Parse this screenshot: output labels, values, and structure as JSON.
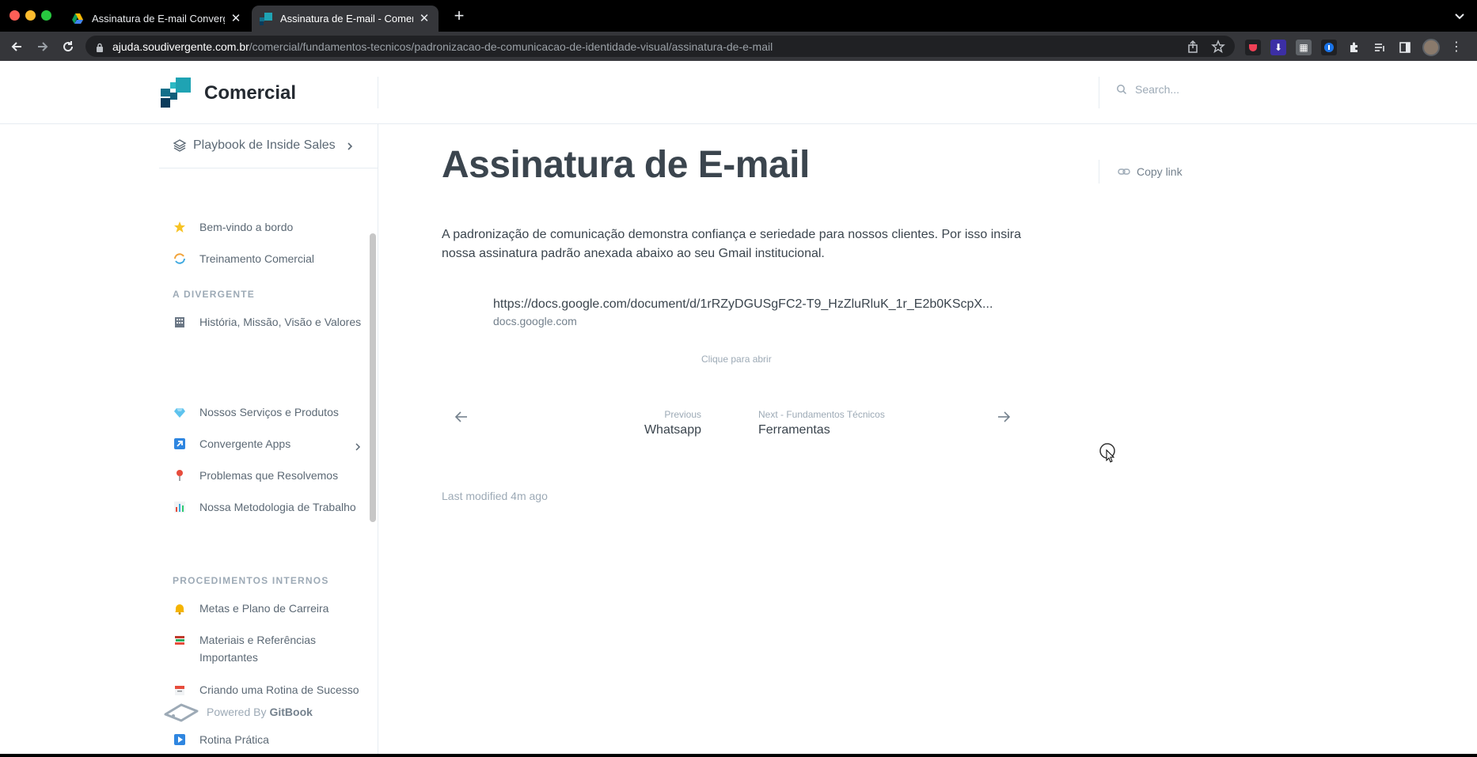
{
  "browser": {
    "tabs": [
      {
        "title": "Assinatura de E-mail Converge",
        "active": false,
        "favicon": "google-drive-icon"
      },
      {
        "title": "Assinatura de E-mail - Comerci",
        "active": true,
        "favicon": "gitbook-space-icon"
      }
    ],
    "url_host": "ajuda.soudivergente.com.br",
    "url_path": "/comercial/fundamentos-tecnicos/padronizacao-de-comunicacao-de-identidade-visual/assinatura-de-e-mail"
  },
  "header": {
    "space_title": "Comercial",
    "search_placeholder": "Search..."
  },
  "sidebar": {
    "space_switch_label": "Playbook de Inside Sales",
    "top_items": [
      {
        "label": "Bem-vindo a bordo",
        "icon": "star-icon"
      },
      {
        "label": "Treinamento Comercial",
        "icon": "cycle-icon"
      }
    ],
    "sections": [
      {
        "title": "A DIVERGENTE",
        "items": [
          {
            "label": "História, Missão, Visão e Valores",
            "icon": "building-icon"
          },
          {
            "label": "Nossos Serviços e Produtos",
            "icon": "gem-icon"
          },
          {
            "label": "Convergente Apps",
            "icon": "arrow-up-right-icon",
            "has_children": true
          },
          {
            "label": "Problemas que Resolvemos",
            "icon": "pin-icon"
          },
          {
            "label": "Nossa  Metodologia de Trabalho",
            "icon": "bar-chart-icon"
          }
        ]
      },
      {
        "title": "PROCEDIMENTOS INTERNOS",
        "items": [
          {
            "label": "Metas e Plano de Carreira",
            "icon": "bell-icon"
          },
          {
            "label": "Materiais e Referências Importantes",
            "icon": "books-icon"
          },
          {
            "label": "Criando uma Rotina de Sucesso",
            "icon": "calendar-icon"
          },
          {
            "label": "Rotina Prática",
            "icon": "play-icon"
          }
        ]
      }
    ],
    "powered_prefix": "Powered By",
    "powered_brand": "GitBook"
  },
  "main": {
    "title": "Assinatura de E-mail",
    "intro": "A padronização de comunicação demonstra confiança e seriedade para nossos clientes. Por isso insira nossa assinatura padrão anexada abaixo ao seu Gmail institucional.",
    "embed": {
      "url": "https://docs.google.com/document/d/1rRZyDGUSgFC2-T9_HzZluRluK_1r_E2b0KScpX...",
      "host": "docs.google.com",
      "caption": "Clique para abrir"
    },
    "pager": {
      "prev_hint": "Previous",
      "prev_label": "Whatsapp",
      "next_hint": "Next - Fundamentos Técnicos",
      "next_label": "Ferramentas"
    },
    "last_modified": "Last modified 4m ago"
  },
  "rail": {
    "copy_link": "Copy link"
  },
  "colors": {
    "accent": "#3884ff",
    "text": "#3b454e",
    "muted": "#9daab6",
    "border": "#e6ecf1"
  }
}
